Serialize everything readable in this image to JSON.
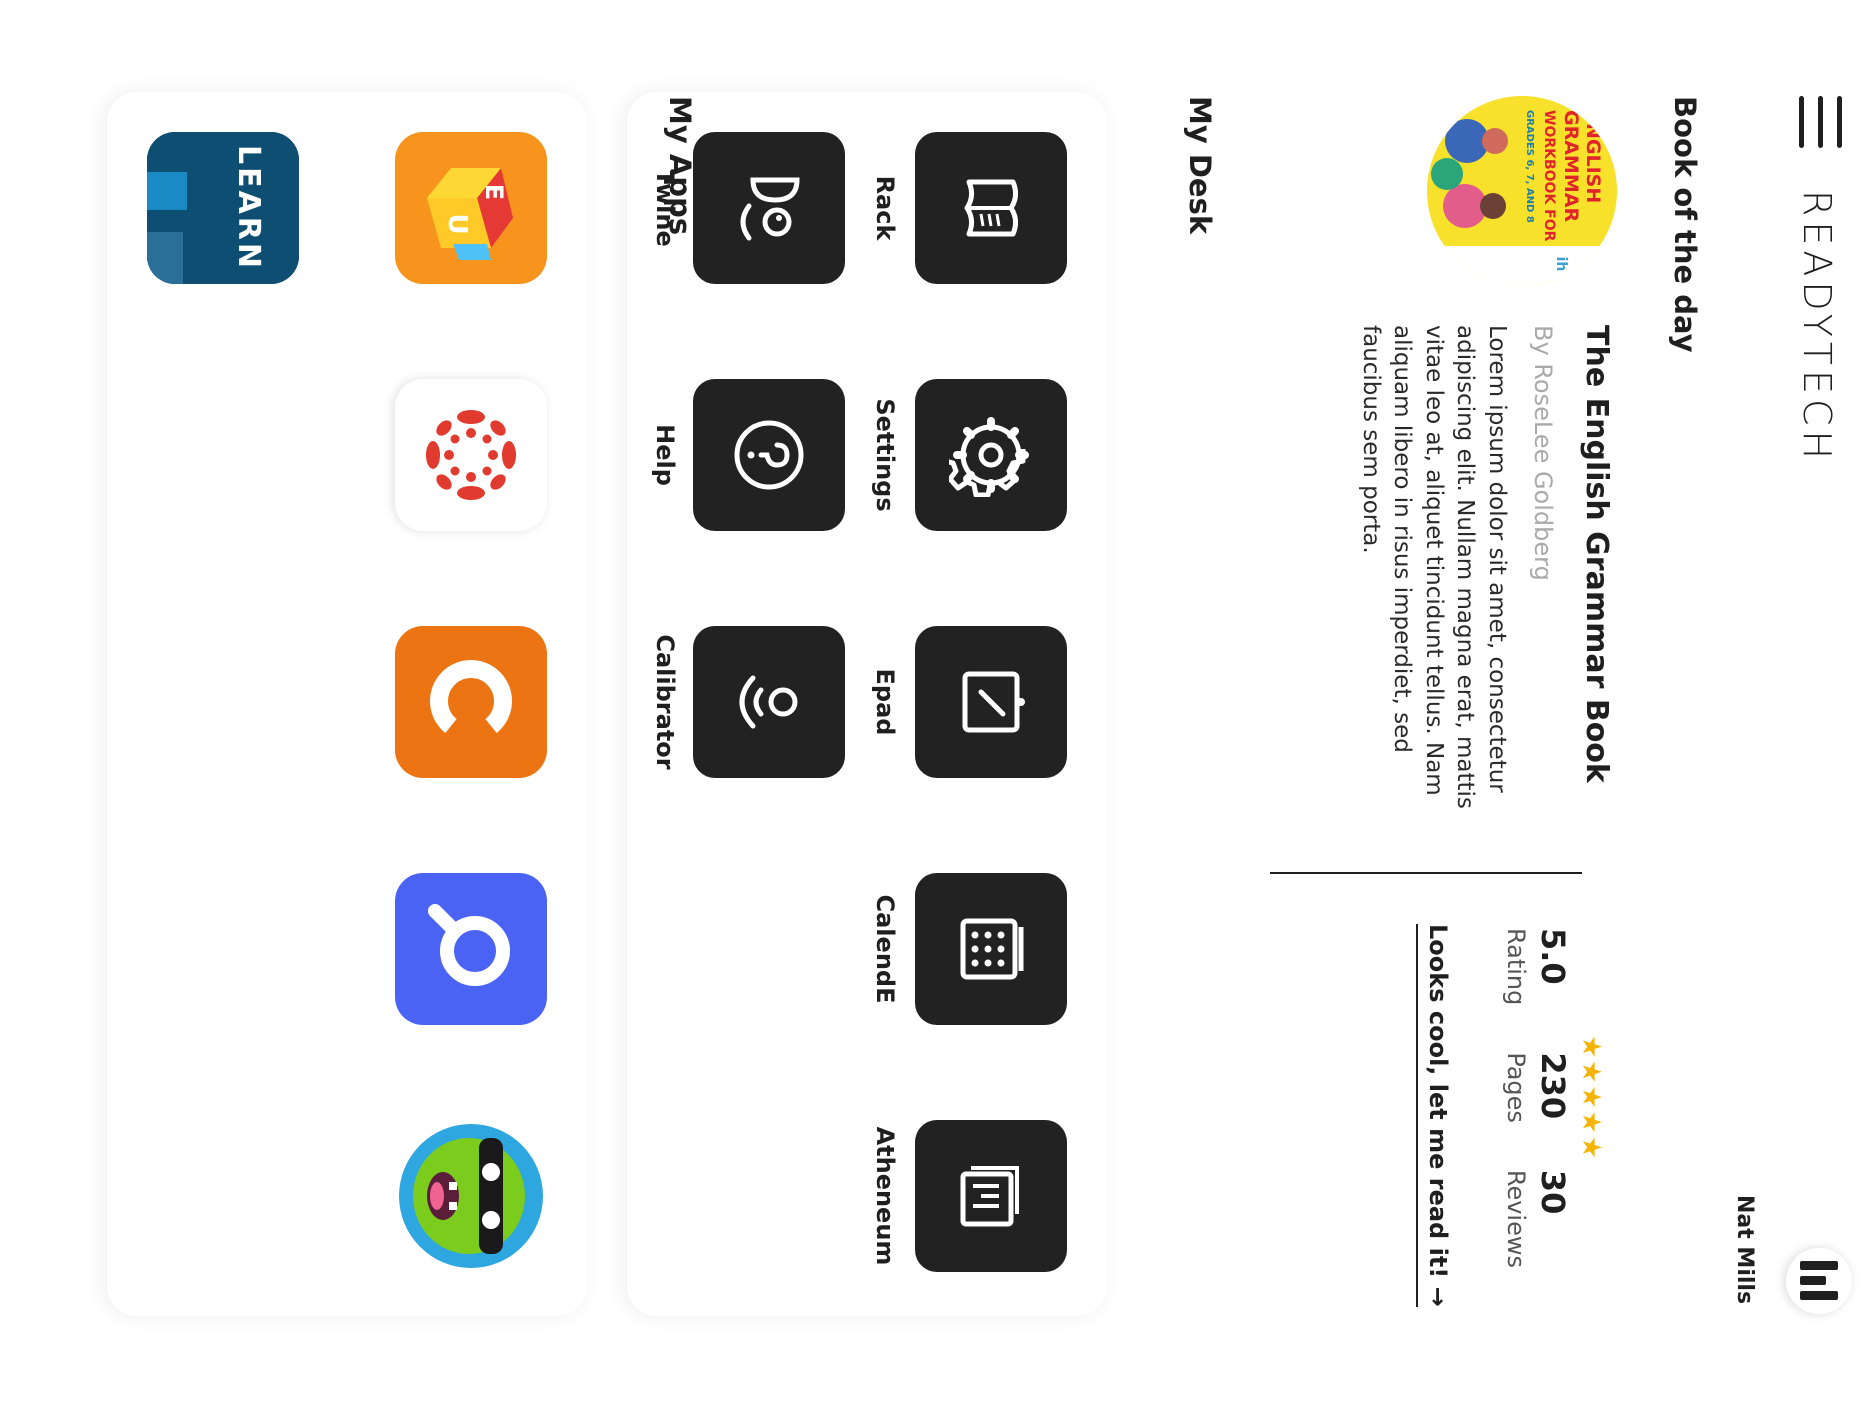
{
  "header": {
    "logo": "READYTECH",
    "user_name": "Nat Mills"
  },
  "book_of_the_day": {
    "section_title": "Book of the day",
    "title": "The English Grammar Book",
    "author": "By RoseLee Goldberg",
    "description": "Lorem ipsum dolor sit amet, consectetur adipiscing elit. Nullam magna erat, mattis vitae leo at, aliquet tincidunt tellus. Nam aliquam libero in risus imperdiet, sed faucibus sem porta.",
    "cover": {
      "line1": "ENGLISH",
      "line2": "GRAMMAR",
      "line3": "WORKBOOK FOR",
      "line4": "GRADES 6, 7, AND 8"
    },
    "stars": 5,
    "stats": [
      {
        "value": "5.0",
        "label": "Rating"
      },
      {
        "value": "230",
        "label": "Pages"
      },
      {
        "value": "30",
        "label": "Reviews"
      }
    ],
    "cta": "Looks cool, let me read it! →"
  },
  "my_desk": {
    "title": "My Desk",
    "items": [
      {
        "label": "Rack",
        "icon": "book-icon"
      },
      {
        "label": "Settings",
        "icon": "gear-icon"
      },
      {
        "label": "Epad",
        "icon": "tablet-pen-icon"
      },
      {
        "label": "CalendE",
        "icon": "calendar-icon"
      },
      {
        "label": "Atheneum",
        "icon": "library-icon"
      },
      {
        "label": "Twine",
        "icon": "twine-face-icon"
      },
      {
        "label": "Help",
        "icon": "question-icon"
      },
      {
        "label": "Calibrator",
        "icon": "calibrator-icon"
      }
    ]
  },
  "my_apps": {
    "title": "My Apps",
    "items": [
      {
        "name": "Edu blocks",
        "icon": "edu-blocks-icon",
        "color": "#f7941d"
      },
      {
        "name": "Canvas",
        "icon": "canvas-icon",
        "color": "#e13b2f"
      },
      {
        "name": "Orange C app",
        "icon": "orange-c-icon",
        "color": "#ec7413"
      },
      {
        "name": "Blue Q app",
        "icon": "blue-q-icon",
        "color": "#4a63f5"
      },
      {
        "name": "ClassDojo",
        "icon": "classdojo-monster-icon",
        "color": "#7ccc1e"
      },
      {
        "name": "Learn",
        "label": "LEARN",
        "icon": "learn-icon",
        "color": "#0e4e72"
      }
    ]
  }
}
